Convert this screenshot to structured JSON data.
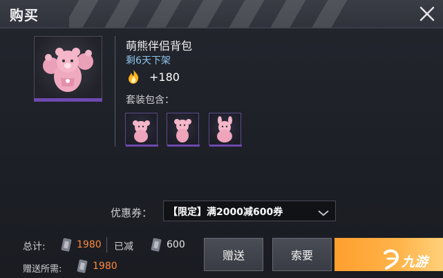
{
  "header": {
    "title": "购买"
  },
  "item": {
    "name": "萌熊伴侣背包",
    "expire": "剩6天下架",
    "points": "+180",
    "set_label": "套装包含："
  },
  "coupon": {
    "label": "优惠券：",
    "value": "【限定】满2000减600券"
  },
  "totals": {
    "total_label": "总计:",
    "total_value": "1980",
    "discount_label": "已减",
    "discount_value": "600",
    "gift_label": "赠送所需:",
    "gift_value": "1980"
  },
  "buttons": {
    "gift": "赠送",
    "request": "索要"
  },
  "watermark": {
    "text": "九游"
  },
  "colors": {
    "accent_purple": "#6f49b0",
    "price_orange": "#ff8a3c",
    "buy_orange": "#ffb44a",
    "expire_blue": "#8fc3ea"
  },
  "icons": [
    "close-icon",
    "flame-icon",
    "coupon-coin-icon",
    "chevron-down-icon",
    "bear-backpack"
  ]
}
